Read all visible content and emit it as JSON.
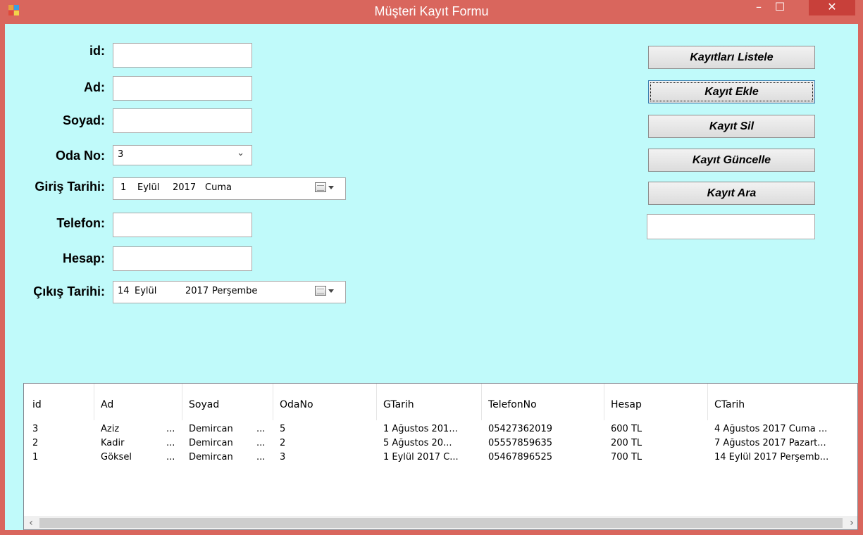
{
  "window": {
    "title": "Müşteri Kayıt Formu",
    "minimize": "–",
    "maximize": "☐",
    "close": "✕"
  },
  "form": {
    "id": {
      "label": "id:",
      "value": ""
    },
    "ad": {
      "label": "Ad:",
      "value": ""
    },
    "soyad": {
      "label": "Soyad:",
      "value": ""
    },
    "oda_no": {
      "label": "Oda No:",
      "value": "3"
    },
    "giris": {
      "label": "Giriş Tarihi:",
      "day": "1",
      "month": "Eylül",
      "year": "2017",
      "weekday": "Cuma"
    },
    "telefon": {
      "label": "Telefon:",
      "value": ""
    },
    "hesap": {
      "label": "Hesap:",
      "value": ""
    },
    "cikis": {
      "label": "Çıkış Tarihi:",
      "day": "14",
      "month": "Eylül",
      "year": "2017",
      "weekday": "Perşembe"
    }
  },
  "buttons": {
    "listele": "Kayıtları Listele",
    "ekle": "Kayıt Ekle",
    "sil": "Kayıt Sil",
    "guncelle": "Kayıt Güncelle",
    "ara": "Kayıt Ara"
  },
  "search": {
    "value": ""
  },
  "grid": {
    "columns": [
      "id",
      "Ad",
      "Soyad",
      "OdaNo",
      "GTarih",
      "TelefonNo",
      "Hesap",
      "CTarih"
    ],
    "rows": [
      [
        "3",
        "Aziz",
        "Demircan",
        "5",
        "1 Ağustos 201...",
        "05427362019",
        "600 TL",
        "4 Ağustos 2017 Cuma ..."
      ],
      [
        "2",
        "Kadir",
        "Demircan",
        "2",
        "5 Ağustos 20...",
        "05557859635",
        "200 TL",
        "7 Ağustos 2017 Pazart..."
      ],
      [
        "1",
        "Göksel",
        "Demircan",
        "3",
        "1 Eylül 2017 C...",
        "05467896525",
        "700 TL",
        "14 Eylül 2017 Perşemb..."
      ]
    ],
    "ellipsis": "...",
    "scroll_left": "‹",
    "scroll_right": "›"
  },
  "icons": {
    "app": "app-icon",
    "calendar": "calendar-icon",
    "dropdown": "chevron-down-icon"
  },
  "colors": {
    "titlebar": "#d9665d",
    "client": "#c0fafa",
    "close": "#c8403a"
  }
}
